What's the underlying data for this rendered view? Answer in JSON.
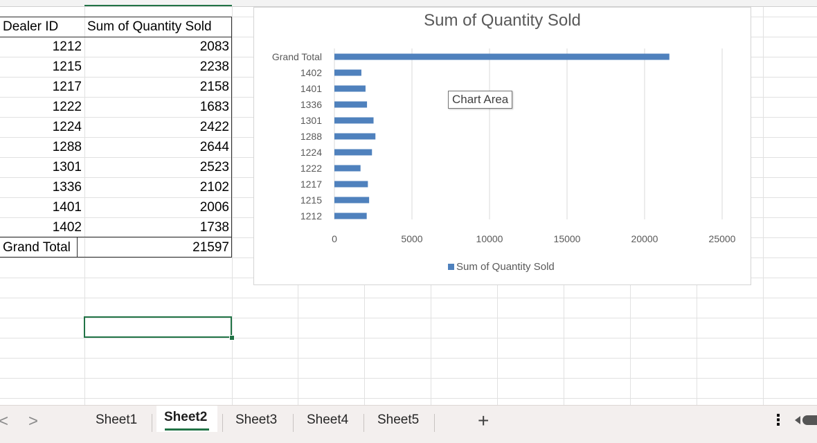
{
  "pivot": {
    "headers": {
      "dealer": "Dealer ID",
      "qty": "Sum of Quantity Sold"
    },
    "rows": [
      {
        "id": "1212",
        "qty": "2083"
      },
      {
        "id": "1215",
        "qty": "2238"
      },
      {
        "id": "1217",
        "qty": "2158"
      },
      {
        "id": "1222",
        "qty": "1683"
      },
      {
        "id": "1224",
        "qty": "2422"
      },
      {
        "id": "1288",
        "qty": "2644"
      },
      {
        "id": "1301",
        "qty": "2523"
      },
      {
        "id": "1336",
        "qty": "2102"
      },
      {
        "id": "1401",
        "qty": "2006"
      },
      {
        "id": "1402",
        "qty": "1738"
      }
    ],
    "grand_total": {
      "label": "Grand Total",
      "qty": "21597"
    }
  },
  "chart_tooltip": "Chart Area",
  "chart_data": {
    "type": "bar",
    "orientation": "horizontal",
    "title": "Sum of Quantity Sold",
    "categories": [
      "Grand Total",
      "1402",
      "1401",
      "1336",
      "1301",
      "1288",
      "1224",
      "1222",
      "1217",
      "1215",
      "1212"
    ],
    "series": [
      {
        "name": "Sum of Quantity Sold",
        "values": [
          21597,
          1738,
          2006,
          2102,
          2523,
          2644,
          2422,
          1683,
          2158,
          2238,
          2083
        ],
        "color": "#4f81bd"
      }
    ],
    "xlim": [
      0,
      25000
    ],
    "xticks": [
      "0",
      "5000",
      "10000",
      "15000",
      "20000",
      "25000"
    ],
    "grid": true,
    "legend": "bottom"
  },
  "tabs": {
    "items": [
      "Sheet1",
      "Sheet2",
      "Sheet3",
      "Sheet4",
      "Sheet5"
    ],
    "active": "Sheet2",
    "add_label": "+",
    "more_label": "⋮",
    "prev_label": "<",
    "next_label": ">"
  },
  "colors": {
    "accent": "#217346",
    "bar": "#4f81bd"
  }
}
